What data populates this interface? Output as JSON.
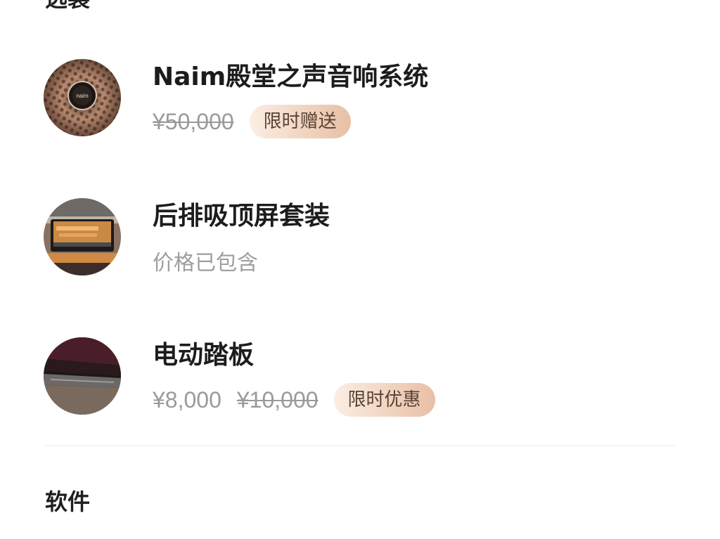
{
  "sections": {
    "options_title": "选装",
    "software_title": "软件"
  },
  "options": [
    {
      "name": "Naim殿堂之声音响系统",
      "original_price": "¥50,000",
      "badge": "限时赠送",
      "image_icon": "naim-speaker-icon"
    },
    {
      "name": "后排吸顶屏套装",
      "note": "价格已包含",
      "image_icon": "rear-ceiling-screen-icon"
    },
    {
      "name": "电动踏板",
      "price": "¥8,000",
      "original_price": "¥10,000",
      "badge": "限时优惠",
      "image_icon": "electric-step-icon"
    }
  ],
  "colors": {
    "badge_gradient_start": "#fbeee4",
    "badge_gradient_end": "#e7bfa5",
    "badge_text": "#5a4236",
    "muted_text": "#9a9a9a"
  }
}
